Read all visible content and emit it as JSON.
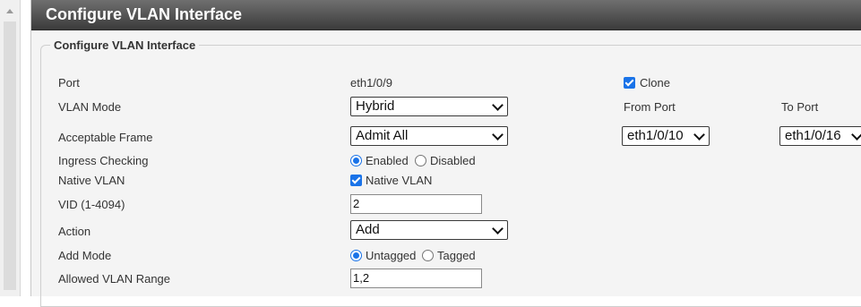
{
  "page": {
    "title": "Configure VLAN Interface"
  },
  "section": {
    "legend": "Configure VLAN Interface"
  },
  "form": {
    "port": {
      "label": "Port",
      "value": "eth1/0/9"
    },
    "vlan_mode": {
      "label": "VLAN Mode",
      "selected": "Hybrid"
    },
    "acceptable_frame": {
      "label": "Acceptable Frame",
      "selected": "Admit All"
    },
    "ingress_checking": {
      "label": "Ingress Checking",
      "options": [
        "Enabled",
        "Disabled"
      ],
      "selected": "Enabled"
    },
    "native_vlan": {
      "label": "Native VLAN",
      "checkbox_label": "Native VLAN",
      "checked": true
    },
    "vid": {
      "label": "VID (1-4094)",
      "value": "2"
    },
    "action": {
      "label": "Action",
      "selected": "Add"
    },
    "add_mode": {
      "label": "Add Mode",
      "options": [
        "Untagged",
        "Tagged"
      ],
      "selected": "Untagged"
    },
    "allowed_vlan_range": {
      "label": "Allowed VLAN Range",
      "value": "1,2"
    }
  },
  "clone": {
    "label": "Clone",
    "checked": true,
    "from_port": {
      "label": "From Port",
      "selected": "eth1/0/10"
    },
    "to_port": {
      "label": "To Port",
      "selected": "eth1/0/16"
    }
  },
  "colors": {
    "titlebar": "#4a4a4a",
    "accent": "#1a73e8",
    "panel_bg": "#f4f4f4"
  }
}
